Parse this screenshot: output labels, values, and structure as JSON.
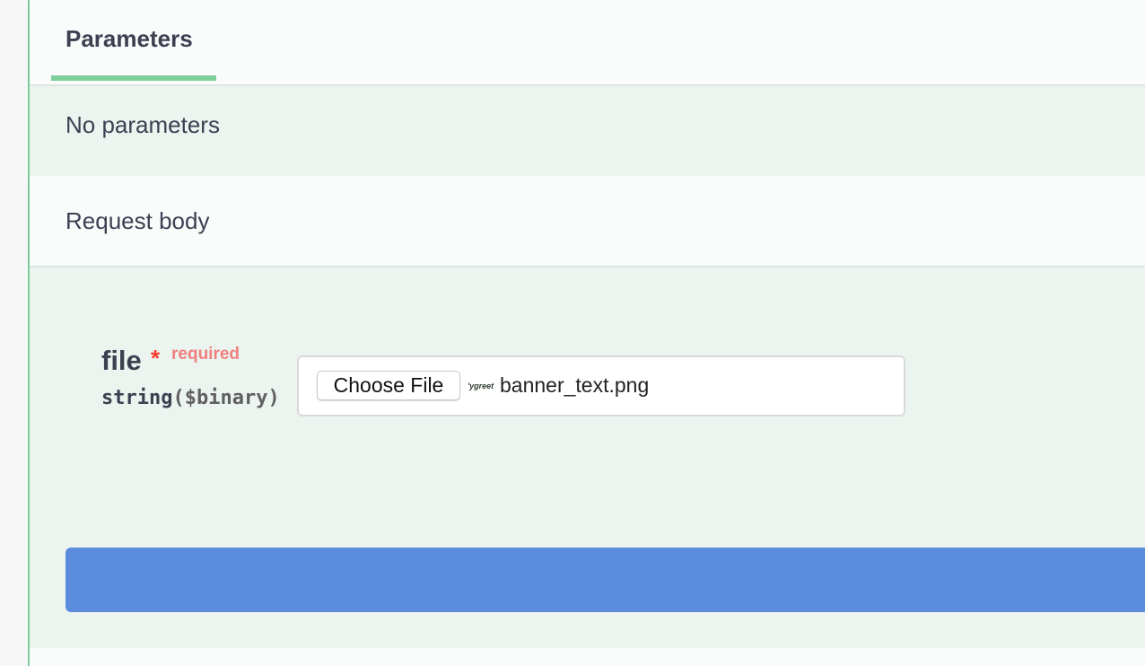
{
  "tabs": {
    "parameters_label": "Parameters"
  },
  "parameters": {
    "empty_text": "No parameters"
  },
  "request_body": {
    "title": "Request body",
    "field": {
      "name": "file",
      "required_marker": "*",
      "required_label": "required",
      "type": "string",
      "format": "($binary)"
    },
    "file_input": {
      "button_label": "Choose File",
      "thumbnail_text": "'ygreet",
      "selected_file": "banner_text.png"
    }
  },
  "colors": {
    "accent_green": "#7fcf9d",
    "block_background": "#ecf4ef",
    "execute_blue": "#5b8ddc",
    "required_red": "#ff3b30"
  }
}
